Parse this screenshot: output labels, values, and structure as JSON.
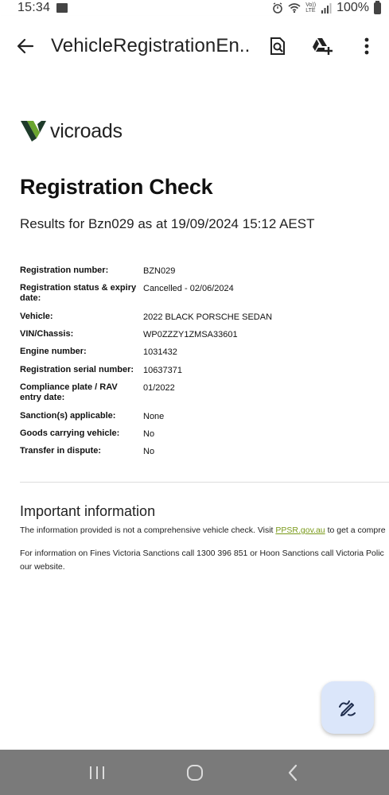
{
  "status_bar": {
    "time": "15:34",
    "battery_text": "100%",
    "volte_label_1": "Vo))",
    "volte_label_2": "LTE"
  },
  "app_bar": {
    "title": "VehicleRegistrationEn..."
  },
  "logo": {
    "text": "vicroads"
  },
  "page": {
    "title": "Registration Check",
    "results_line": "Results for Bzn029 as at 19/09/2024 15:12 AEST"
  },
  "details": [
    {
      "label": "Registration number:",
      "value": "BZN029"
    },
    {
      "label": "Registration status & expiry date:",
      "value": "Cancelled - 02/06/2024"
    },
    {
      "label": "Vehicle:",
      "value": "2022 BLACK PORSCHE SEDAN"
    },
    {
      "label": "VIN/Chassis:",
      "value": "WP0ZZZY1ZMSA33601"
    },
    {
      "label": "Engine number:",
      "value": "1031432"
    },
    {
      "label": "Registration serial number:",
      "value": "10637371"
    },
    {
      "label": "Compliance plate / RAV entry date:",
      "value": "01/2022"
    },
    {
      "label": "Sanction(s) applicable:",
      "value": "None"
    },
    {
      "label": "Goods carrying vehicle:",
      "value": "No"
    },
    {
      "label": "Transfer in dispute:",
      "value": "No"
    }
  ],
  "important": {
    "heading": "Important information",
    "p1_before": "The information provided is not a comprehensive vehicle check. Visit ",
    "p1_link": "PPSR.gov.au",
    "p1_after": " to get a compre",
    "p2_line1": "For information on Fines Victoria Sanctions call 1300 396 851 or Hoon Sanctions call Victoria Polic",
    "p2_line2": "our website."
  },
  "colors": {
    "link": "#7a9a1a",
    "fab_bg": "#dbe6fa",
    "nav_bar": "#7a7a7a",
    "logo_green": "#6aa52e",
    "logo_dark": "#1e3b2a"
  },
  "icons": {
    "back": "arrow-left-icon",
    "find_in_page": "find-in-page-icon",
    "add_to_drive": "add-to-drive-icon",
    "more": "more-vert-icon",
    "fab": "edit-pen-icon",
    "nav_recents": "recents-icon",
    "nav_home": "home-icon",
    "nav_back": "nav-back-icon"
  }
}
